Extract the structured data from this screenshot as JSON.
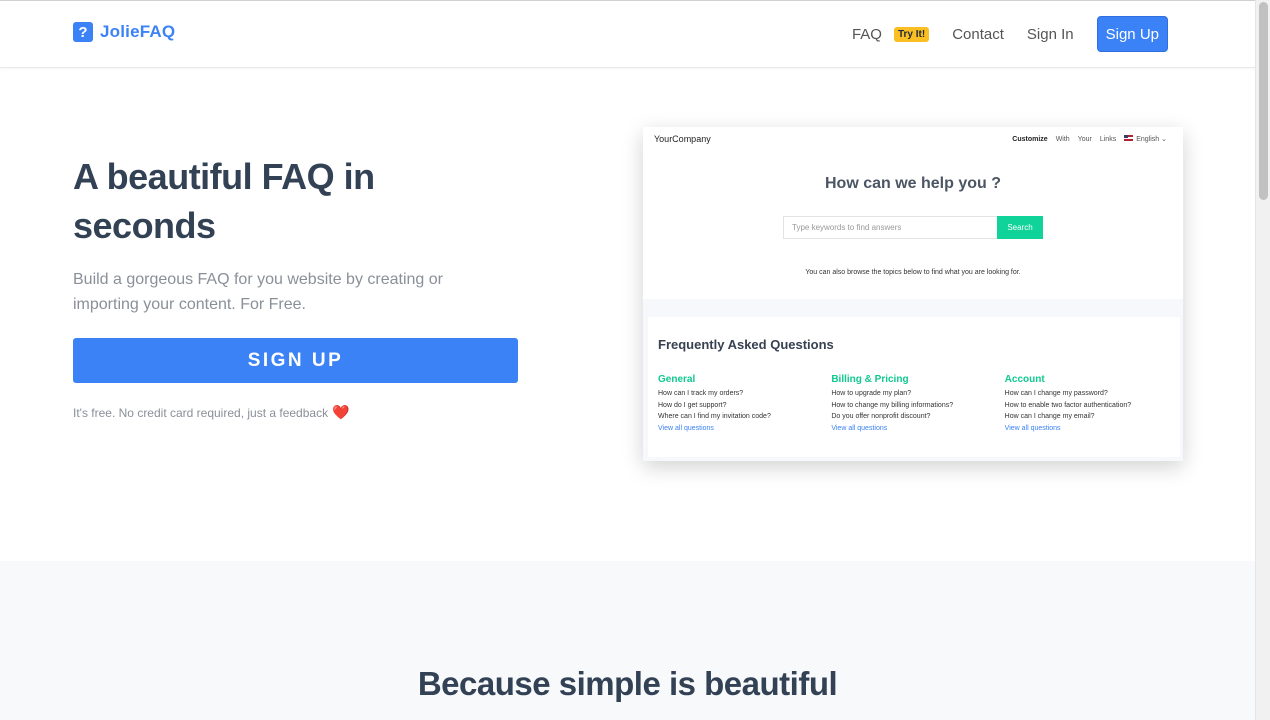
{
  "navbar": {
    "brand_icon": "?",
    "brand_name": "JolieFAQ",
    "faq_label": "FAQ",
    "faq_badge": "Try It!",
    "contact_label": "Contact",
    "signin_label": "Sign In",
    "signup_label": "Sign Up"
  },
  "hero": {
    "title": "A beautiful FAQ in seconds",
    "subtitle": "Build a gorgeous FAQ for you website by creating or importing your content. For Free.",
    "cta_label": "SIGN UP",
    "note": "It's free. No credit card required, just a feedback",
    "note_icon": "❤️"
  },
  "preview": {
    "brand": "YourCompany",
    "nav_links": [
      "Customize",
      "With",
      "Your",
      "Links"
    ],
    "language": "English",
    "language_caret": "⌄",
    "title": "How can we help you ?",
    "search_placeholder": "Type keywords to find answers",
    "search_button": "Search",
    "browse_text": "You can also browse the topics below to find what you are looking for.",
    "faq_title": "Frequently Asked Questions",
    "columns": [
      {
        "title": "General",
        "questions": [
          "How can I track my orders?",
          "How do I get support?",
          "Where can I find my invitation code?"
        ],
        "view_all": "View all questions"
      },
      {
        "title": "Billing & Pricing",
        "questions": [
          "How to upgrade my plan?",
          "How to change my billing informations?",
          "Do you offer nonprofit discount?"
        ],
        "view_all": "View all questions"
      },
      {
        "title": "Account",
        "questions": [
          "How can I change my password?",
          "How to enable two factor authentication?",
          "How can I change my email?"
        ],
        "view_all": "View all questions"
      }
    ]
  },
  "section2": {
    "title": "Because simple is beautiful"
  },
  "colors": {
    "primary": "#3b82f6",
    "badge": "#fbbf24",
    "accent_green": "#10c98f",
    "heading": "#334155"
  }
}
